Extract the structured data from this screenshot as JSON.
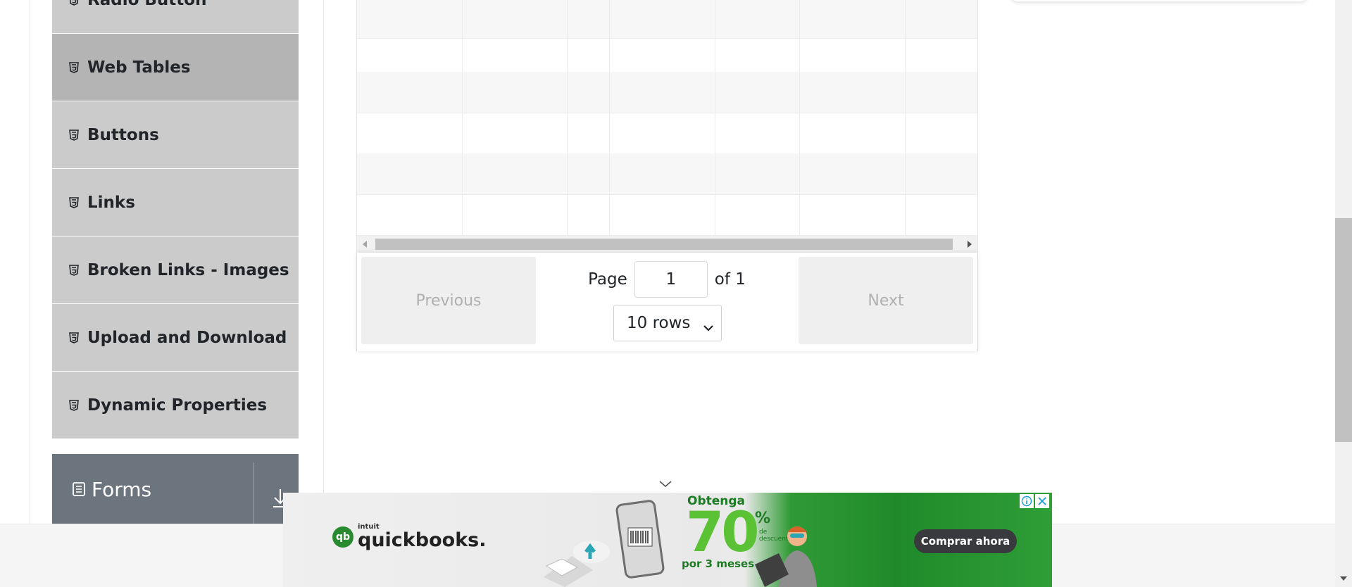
{
  "sidebar": {
    "items": [
      {
        "label": "Radio Button",
        "icon": "html5-icon"
      },
      {
        "label": "Web Tables",
        "icon": "html5-icon",
        "active": true
      },
      {
        "label": "Buttons",
        "icon": "html5-icon"
      },
      {
        "label": "Links",
        "icon": "html5-icon"
      },
      {
        "label": "Broken Links - Images",
        "icon": "html5-icon"
      },
      {
        "label": "Upload and Download",
        "icon": "html5-icon"
      },
      {
        "label": "Dynamic Properties",
        "icon": "html5-icon"
      }
    ],
    "group": {
      "label": "Forms",
      "icon": "document-icon",
      "toggle_icon": "download-arrow-icon"
    }
  },
  "table": {
    "column_count": 7,
    "visible_empty_rows": 6
  },
  "pagination": {
    "previous_label": "Previous",
    "next_label": "Next",
    "page_label": "Page",
    "page_value": "1",
    "of_label": "of 1",
    "rows_selected": "10 rows",
    "rows_options": [
      "10 rows"
    ]
  },
  "ad": {
    "brand_small": "intuit",
    "brand": "quickbooks.",
    "logo_mark": "qb",
    "promo_top": "Obtenga",
    "promo_number": "70",
    "promo_percent": "%",
    "promo_de": "de",
    "promo_descuento": "descuento",
    "promo_sub": "por 3 meses",
    "cta": "Comprar ahora"
  },
  "colors": {
    "menu_bg": "#cbcbcb",
    "menu_active_bg": "#b4b4b4",
    "group_bg": "#6c757d",
    "ad_green": "#2f9a35",
    "cta_bg": "#393a3d"
  }
}
